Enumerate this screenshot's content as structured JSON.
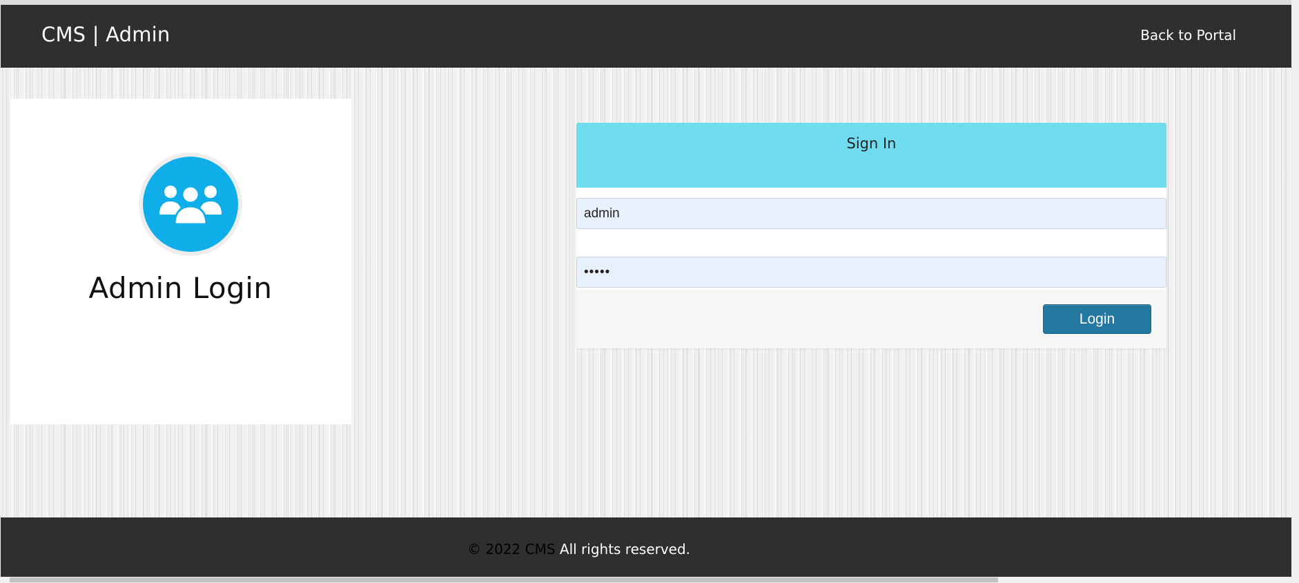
{
  "navbar": {
    "brand": "CMS | Admin",
    "back_link": "Back to Portal"
  },
  "left_panel": {
    "avatar_icon": "users-group-icon",
    "title": "Admin Login"
  },
  "login_card": {
    "header_title": "Sign In",
    "username_value": "admin",
    "password_value": "•••••",
    "login_button": "Login"
  },
  "footer": {
    "copyright_prefix": "© 2022 CMS",
    "copyright_suffix": " All rights reserved."
  },
  "colors": {
    "navbar": "#2f2f2f",
    "card_header": "#6fdcf0",
    "avatar": "#10aee8",
    "button": "#23789f",
    "input_fill": "#e8f0fe"
  }
}
